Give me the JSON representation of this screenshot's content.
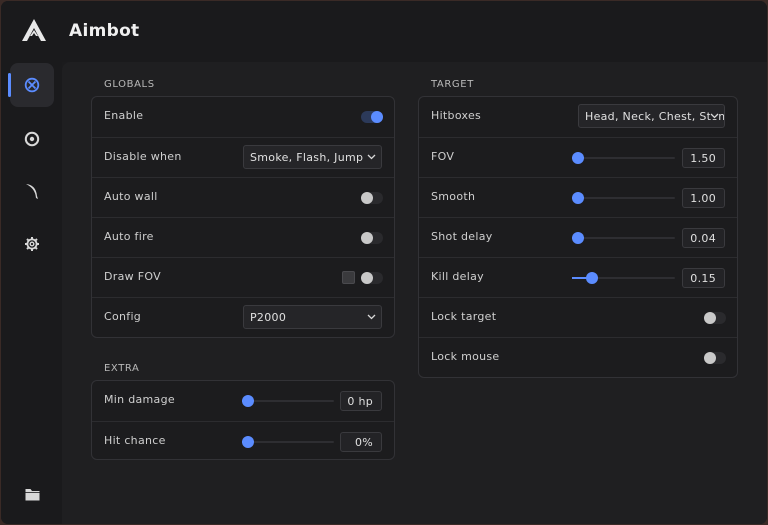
{
  "app": {
    "title": "Aimbot",
    "logo_icon": "aimbot-logo-icon",
    "accent_color": "#5b8cff"
  },
  "sidebar": {
    "items": [
      {
        "icon": "crosshair-icon",
        "active": true
      },
      {
        "icon": "eye-icon",
        "active": false
      },
      {
        "icon": "knife-icon",
        "active": false
      },
      {
        "icon": "gear-icon",
        "active": false
      },
      {
        "icon": "folder-icon",
        "active": false
      }
    ]
  },
  "globals": {
    "section_label": "GLOBALS",
    "enable": {
      "label": "Enable",
      "value": true
    },
    "disable_when": {
      "label": "Disable when",
      "value": "Smoke, Flash, Jump"
    },
    "auto_wall": {
      "label": "Auto wall",
      "value": false
    },
    "auto_fire": {
      "label": "Auto fire",
      "value": false
    },
    "draw_fov": {
      "label": "Draw FOV",
      "value": false,
      "color": "#3a3a3d"
    },
    "config": {
      "label": "Config",
      "value": "P2000"
    }
  },
  "extra": {
    "section_label": "EXTRA",
    "min_damage": {
      "label": "Min damage",
      "value": 0,
      "display": "0 hp"
    },
    "hit_chance": {
      "label": "Hit chance",
      "value": 0,
      "display": "0%"
    }
  },
  "target": {
    "section_label": "TARGET",
    "hitboxes": {
      "label": "Hitboxes",
      "value": "Head, Neck, Chest, Stomach"
    },
    "fov": {
      "label": "FOV",
      "value": 1.5,
      "display": "1.50",
      "fraction": 0.03
    },
    "smooth": {
      "label": "Smooth",
      "value": 1.0,
      "display": "1.00",
      "fraction": 0.05
    },
    "shot_delay": {
      "label": "Shot delay",
      "value": 0.04,
      "display": "0.04",
      "fraction": 0.06
    },
    "kill_delay": {
      "label": "Kill delay",
      "value": 0.15,
      "display": "0.15",
      "fraction": 0.19
    },
    "lock_target": {
      "label": "Lock target",
      "value": false
    },
    "lock_mouse": {
      "label": "Lock mouse",
      "value": false
    }
  }
}
